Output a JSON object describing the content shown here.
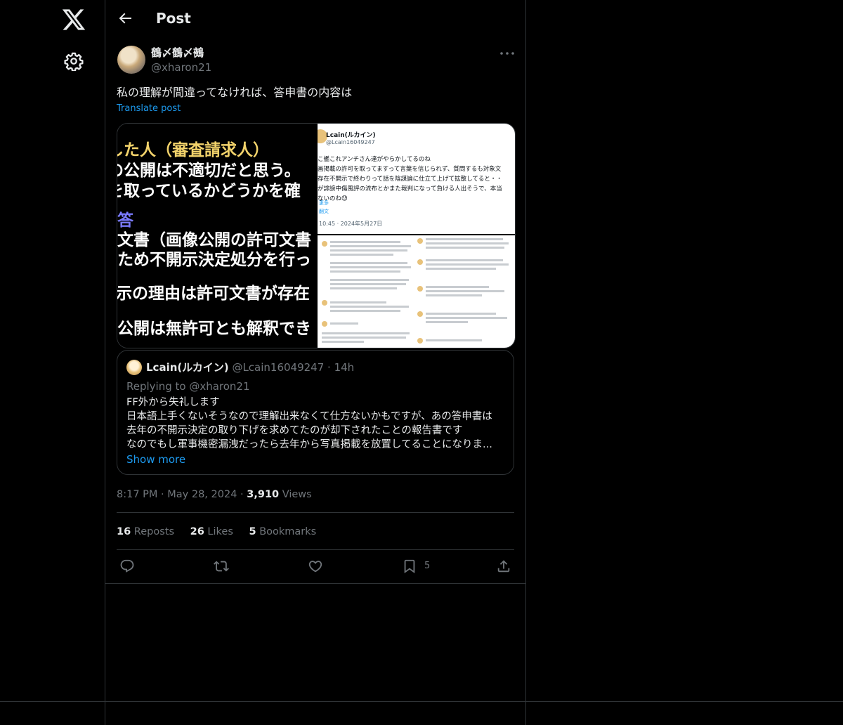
{
  "header": {
    "title": "Post"
  },
  "tweet": {
    "display_name": "鶴〆鶴〆鵺",
    "handle": "@xharon21",
    "text": "私の理解が間違ってなければ、答申書の内容は",
    "translate_label": "Translate post"
  },
  "media": {
    "left_lines": [
      "した人（審査請求人）",
      "の公開は不適切だと思う。",
      "を取っているかどうかを確",
      "答",
      "文書（画像公開の許可文書",
      "ため不開示決定処分を行っ",
      "示の理由は許可文書が存在",
      "公開は無許可とも解釈でき"
    ],
    "right_top": {
      "name": "Lcain(ルカイン)",
      "handle": "@Lcain16049247",
      "lines": [
        "こ艦これアンチさん達がやらかしてるのね",
        "画掲載の許可を取ってますって言葉を信じられず、質問するも対象文",
        "存在不開示で終わりって話を陰謀論に仕立て上げて拡散してると・・",
        "が誹謗中傷風評の流布とかまた裁判になって負ける人出そうで、本当",
        "ないのね😓"
      ],
      "more": "更多",
      "translate": "翻文",
      "time": "10:45 · 2024年5月27日"
    }
  },
  "quote": {
    "name": "Lcain(ルカイン)",
    "handle": "@Lcain16049247",
    "time": "14h",
    "replying": "Replying to @xharon21",
    "lines": [
      "FF外から失礼します",
      "日本語上手くないそうなので理解出来なくて仕方ないかもですが、あの答申書は",
      "去年の不開示決定の取り下げを求めてたのが却下されたことの報告書です",
      "なのでもし軍事機密漏洩だったら去年から写真掲載を放置してることになりま..."
    ],
    "show_more": "Show more"
  },
  "meta": {
    "time": "8:17 PM",
    "date": "May 28, 2024",
    "views_count": "3,910",
    "views_label": "Views"
  },
  "stats": {
    "reposts_count": "16",
    "reposts_label": "Reposts",
    "likes_count": "26",
    "likes_label": "Likes",
    "bookmarks_count": "5",
    "bookmarks_label": "Bookmarks"
  },
  "actions": {
    "bookmark_count": "5"
  },
  "icons": [
    "x-logo-icon",
    "settings-gear-icon",
    "back-arrow-icon",
    "more-dots-icon",
    "reply-icon",
    "repost-icon",
    "like-icon",
    "bookmark-icon",
    "share-icon"
  ]
}
